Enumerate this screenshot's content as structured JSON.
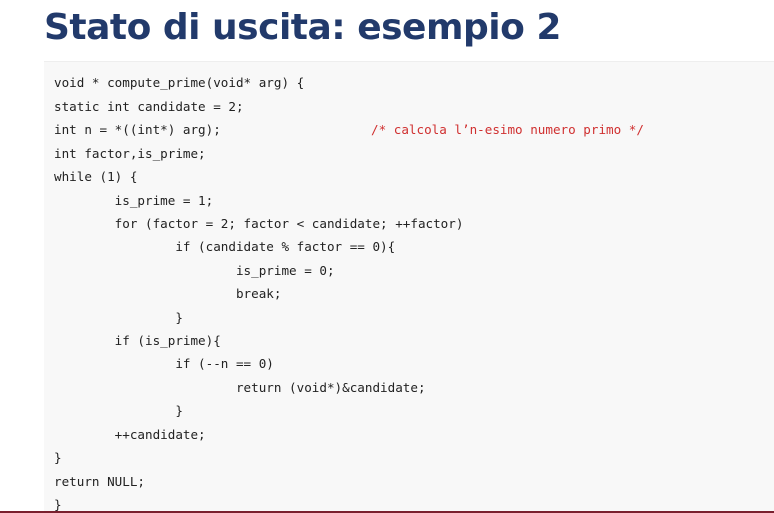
{
  "slide": {
    "title": "Stato di uscita: esempio 2"
  },
  "code": {
    "lines": [
      "void * compute_prime(void* arg) {",
      "static int candidate = 2;",
      "int n = *((int*) arg);",
      "int factor,is_prime;",
      "while (1) {",
      "        is_prime = 1;",
      "        for (factor = 2; factor < candidate; ++factor)",
      "                if (candidate % factor == 0){",
      "                        is_prime = 0;",
      "                        break;",
      "                }",
      "        if (is_prime){",
      "                if (--n == 0)",
      "                        return (void*)&candidate;",
      "                }",
      "        ++candidate;",
      "}",
      "return NULL;",
      "}"
    ],
    "comment_line3": "/* calcola l’n-esimo numero primo */"
  },
  "colors": {
    "title": "#223a6b",
    "code_text": "#222222",
    "comment": "#d03030",
    "panel_bg": "#f8f8f8",
    "bottom_rule": "#7a1f2e"
  }
}
